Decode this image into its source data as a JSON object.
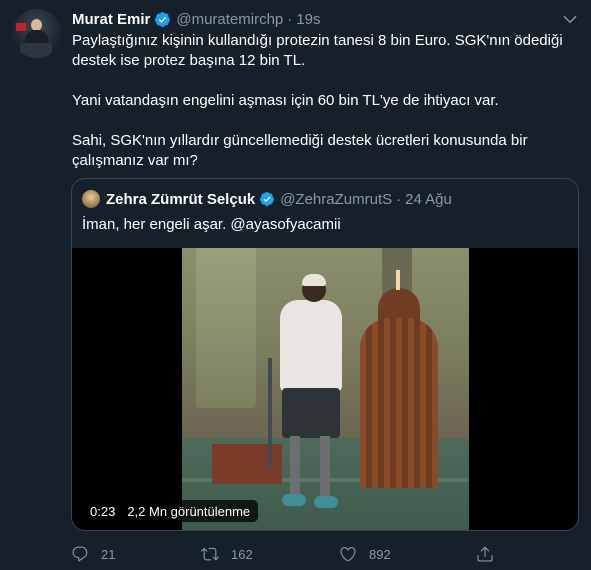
{
  "tweet": {
    "author_name": "Murat Emir",
    "handle": "@muratemirchp",
    "separator": "·",
    "time": "19s",
    "paragraphs": [
      "Paylaştığınız kişinin kullandığı protezin tanesi 8 bin Euro. SGK'nın ödediği destek ise protez başına 12 bin TL.",
      "Yani vatandaşın engelini aşması için 60 bin TL'ye de ihtiyacı var.",
      "Sahi, SGK'nın yıllardır güncellemediği destek ücretleri konusunda bir çalışmanız var mı?"
    ]
  },
  "quoted": {
    "author_name": "Zehra Zümrüt Selçuk",
    "handle": "@ZehraZumrutS",
    "separator": "·",
    "time": "24 Ağu",
    "text": "İman, her engeli aşar. @ayasofyacamii",
    "video": {
      "duration": "0:23",
      "views": "2,2 Mn görüntülenme"
    }
  },
  "actions": {
    "replies": "21",
    "retweets": "162",
    "likes": "892"
  },
  "colors": {
    "background": "#15202b",
    "secondary_text": "#8899a6",
    "verified": "#1da1f2",
    "border": "#38444d"
  },
  "icons": [
    "verified-badge-icon",
    "chevron-down-icon",
    "reply-icon",
    "retweet-icon",
    "like-icon",
    "share-icon"
  ]
}
